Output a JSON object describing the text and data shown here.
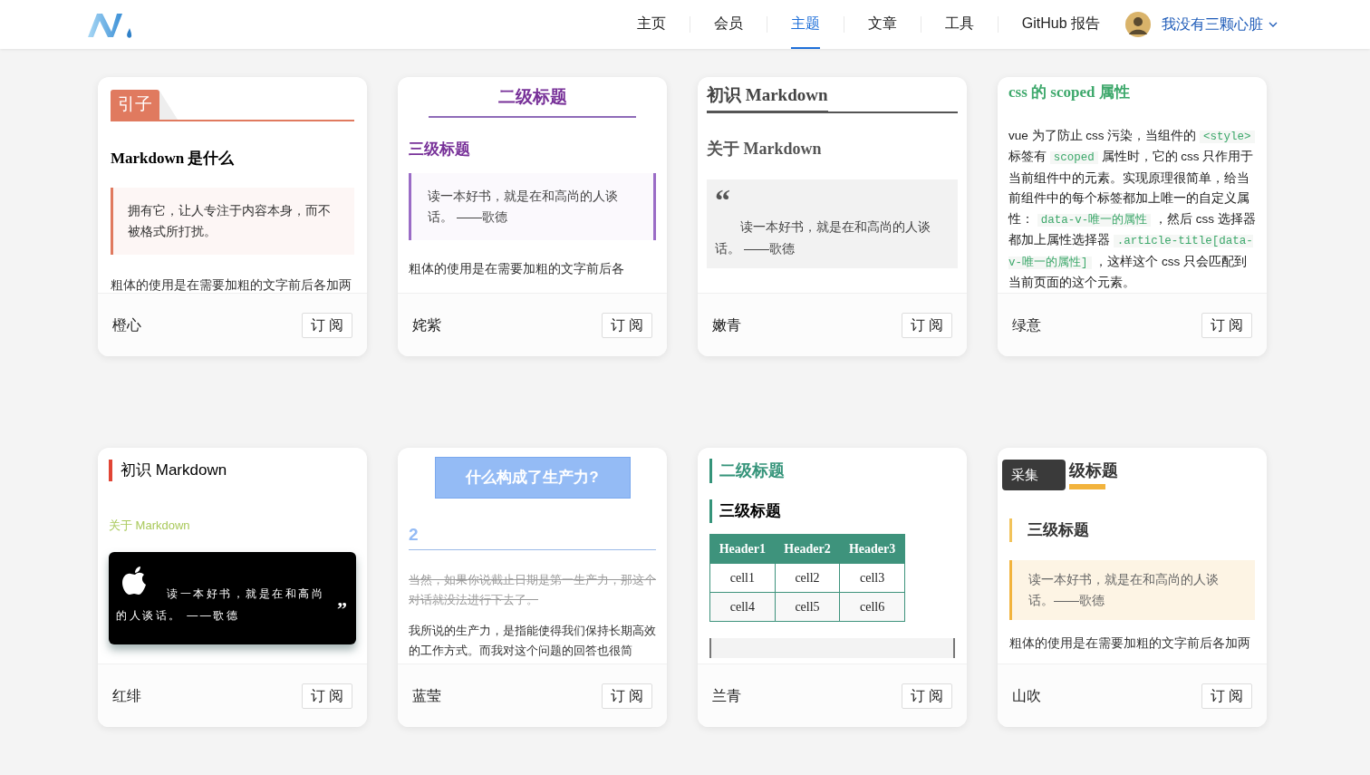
{
  "nav": {
    "items": [
      {
        "label": "主页",
        "selected": false
      },
      {
        "label": "会员",
        "selected": false
      },
      {
        "label": "主题",
        "selected": true
      },
      {
        "label": "文章",
        "selected": false
      },
      {
        "label": "工具",
        "selected": false
      },
      {
        "label": "GitHub 报告",
        "selected": false
      }
    ],
    "user": {
      "name": "我没有三颗心脏"
    }
  },
  "cards": [
    {
      "kind": "orange",
      "badge": "引子",
      "heading": "Markdown 是什么",
      "quote": "拥有它，让人专注于内容本身，而不被格式所打扰。",
      "body": "粗体的使用是在需要加粗的文字前后各加两",
      "name": "橙心",
      "button": "订 阅"
    },
    {
      "kind": "purple",
      "h2": "二级标题",
      "h3": "三级标题",
      "quote": "读一本好书，就是在和高尚的人谈话。 ——歌德",
      "body": "粗体的使用是在需要加粗的文字前后各",
      "name": "姹紫",
      "button": "订 阅"
    },
    {
      "kind": "cyan",
      "h2": "初识 Markdown",
      "h3": "关于 Markdown",
      "quote_mark": "“",
      "quote": "读一本好书，就是在和高尚的人谈话。 ——歌德",
      "name": "嫩青",
      "button": "订 阅"
    },
    {
      "kind": "green",
      "h2": "css 的 scoped 属性",
      "segments": [
        {
          "text": "vue 为了防止 css 污染，当组件的 ",
          "code": false
        },
        {
          "text": "<style>",
          "code": true
        },
        {
          "text": " 标签有 ",
          "code": false
        },
        {
          "text": "scoped",
          "code": true
        },
        {
          "text": " 属性时，它的 css 只作用于当前组件中的元素。实现原理很简单，给当前组件中的每个标签都加上唯一的自定义属性： ",
          "code": false
        },
        {
          "text": "data-v-唯一的属性",
          "code": true
        },
        {
          "text": " ，然后 css 选择器都加上属性选择器 ",
          "code": false
        },
        {
          "text": ".article-title[data-v-唯一的属性]",
          "code": true
        },
        {
          "text": " ，这样这个 css 只会匹配到当前页面的这个元素。",
          "code": false
        }
      ],
      "name": "绿意",
      "button": "订 阅"
    },
    {
      "kind": "red",
      "h2": "初识 Markdown",
      "h3": "关于 Markdown",
      "quote": "读一本好书，就是在和高尚的人谈话。 ——歌德",
      "close_mark": "”",
      "name": "红绯",
      "button": "订 阅"
    },
    {
      "kind": "blue",
      "h1": "什么构成了生产力?",
      "h2": "2",
      "deleted": "当然，如果你说截止日期是第一生产力，那这个对话就没法进行下去了。",
      "body": "我所说的生产力，是指能使得我们保持长期高效的工作方式。而我对这个问题的回答也很简",
      "name": "蓝莹",
      "button": "订 阅"
    },
    {
      "kind": "teal",
      "h2": "二级标题",
      "h3": "三级标题",
      "table": {
        "columns": [
          "Header1",
          "Header2",
          "Header3"
        ],
        "rows": [
          [
            "cell1",
            "cell2",
            "cell3"
          ],
          [
            "cell4",
            "cell5",
            "cell6"
          ]
        ]
      },
      "name": "兰青",
      "button": "订 阅"
    },
    {
      "kind": "yellow",
      "h2": "级标题",
      "overlay": "采集",
      "h3": "三级标题",
      "quote": "读一本好书，就是在和高尚的人谈话。——歌德",
      "body": "粗体的使用是在需要加粗的文字前后各加两",
      "name": "山吹",
      "button": "订 阅"
    }
  ]
}
